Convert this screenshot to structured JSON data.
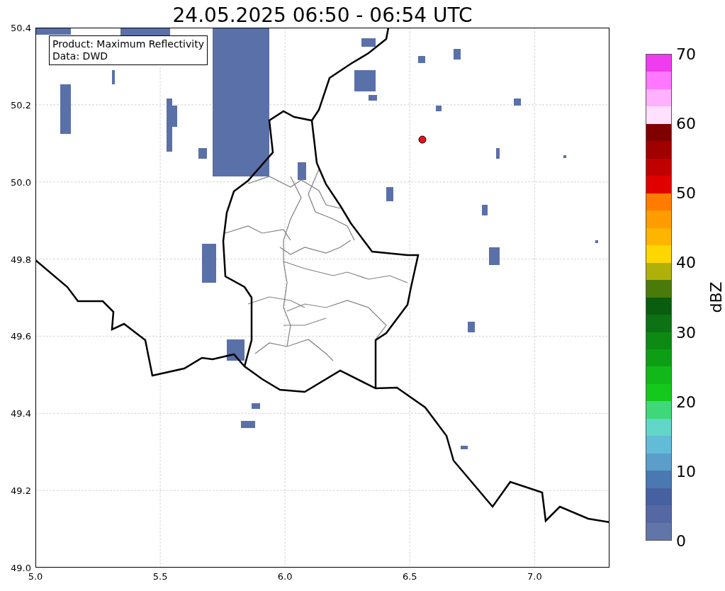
{
  "title": "24.05.2025 06:50 - 06:54 UTC",
  "map": {
    "legend_lines": [
      "Product: Maximum Reflectivity",
      "Data: DWD"
    ],
    "y_ticks": [
      "50.4",
      "50.2",
      "50.0",
      "49.8",
      "49.6",
      "49.4",
      "49.2",
      "49.0"
    ],
    "x_ticks": [
      "5.0",
      "5.5",
      "6.0",
      "6.5",
      "7.0"
    ]
  },
  "colorbar": {
    "label": "dBZ",
    "ticks": [
      "70",
      "60",
      "50",
      "40",
      "30",
      "20",
      "10",
      "0"
    ],
    "segments": [
      {
        "color": "#ee3cee"
      },
      {
        "color": "#ff78ff"
      },
      {
        "color": "#ffb0ff"
      },
      {
        "color": "#ffe0ff"
      },
      {
        "color": "#800000"
      },
      {
        "color": "#a00000"
      },
      {
        "color": "#c00000"
      },
      {
        "color": "#e00000"
      },
      {
        "color": "#ff7c00"
      },
      {
        "color": "#ff9c00"
      },
      {
        "color": "#ffb400"
      },
      {
        "color": "#ffd700"
      },
      {
        "color": "#b0b00a"
      },
      {
        "color": "#4a7a0a"
      },
      {
        "color": "#0a5c0e"
      },
      {
        "color": "#0c7214"
      },
      {
        "color": "#0d8a14"
      },
      {
        "color": "#0e9e16"
      },
      {
        "color": "#12b81a"
      },
      {
        "color": "#14c81c"
      },
      {
        "color": "#3fd878"
      },
      {
        "color": "#62d6c8"
      },
      {
        "color": "#62bcd8"
      },
      {
        "color": "#5a9ec9"
      },
      {
        "color": "#4a78b0"
      },
      {
        "color": "#4660a0"
      },
      {
        "color": "#5568a3"
      },
      {
        "color": "#6175a8"
      }
    ]
  }
}
